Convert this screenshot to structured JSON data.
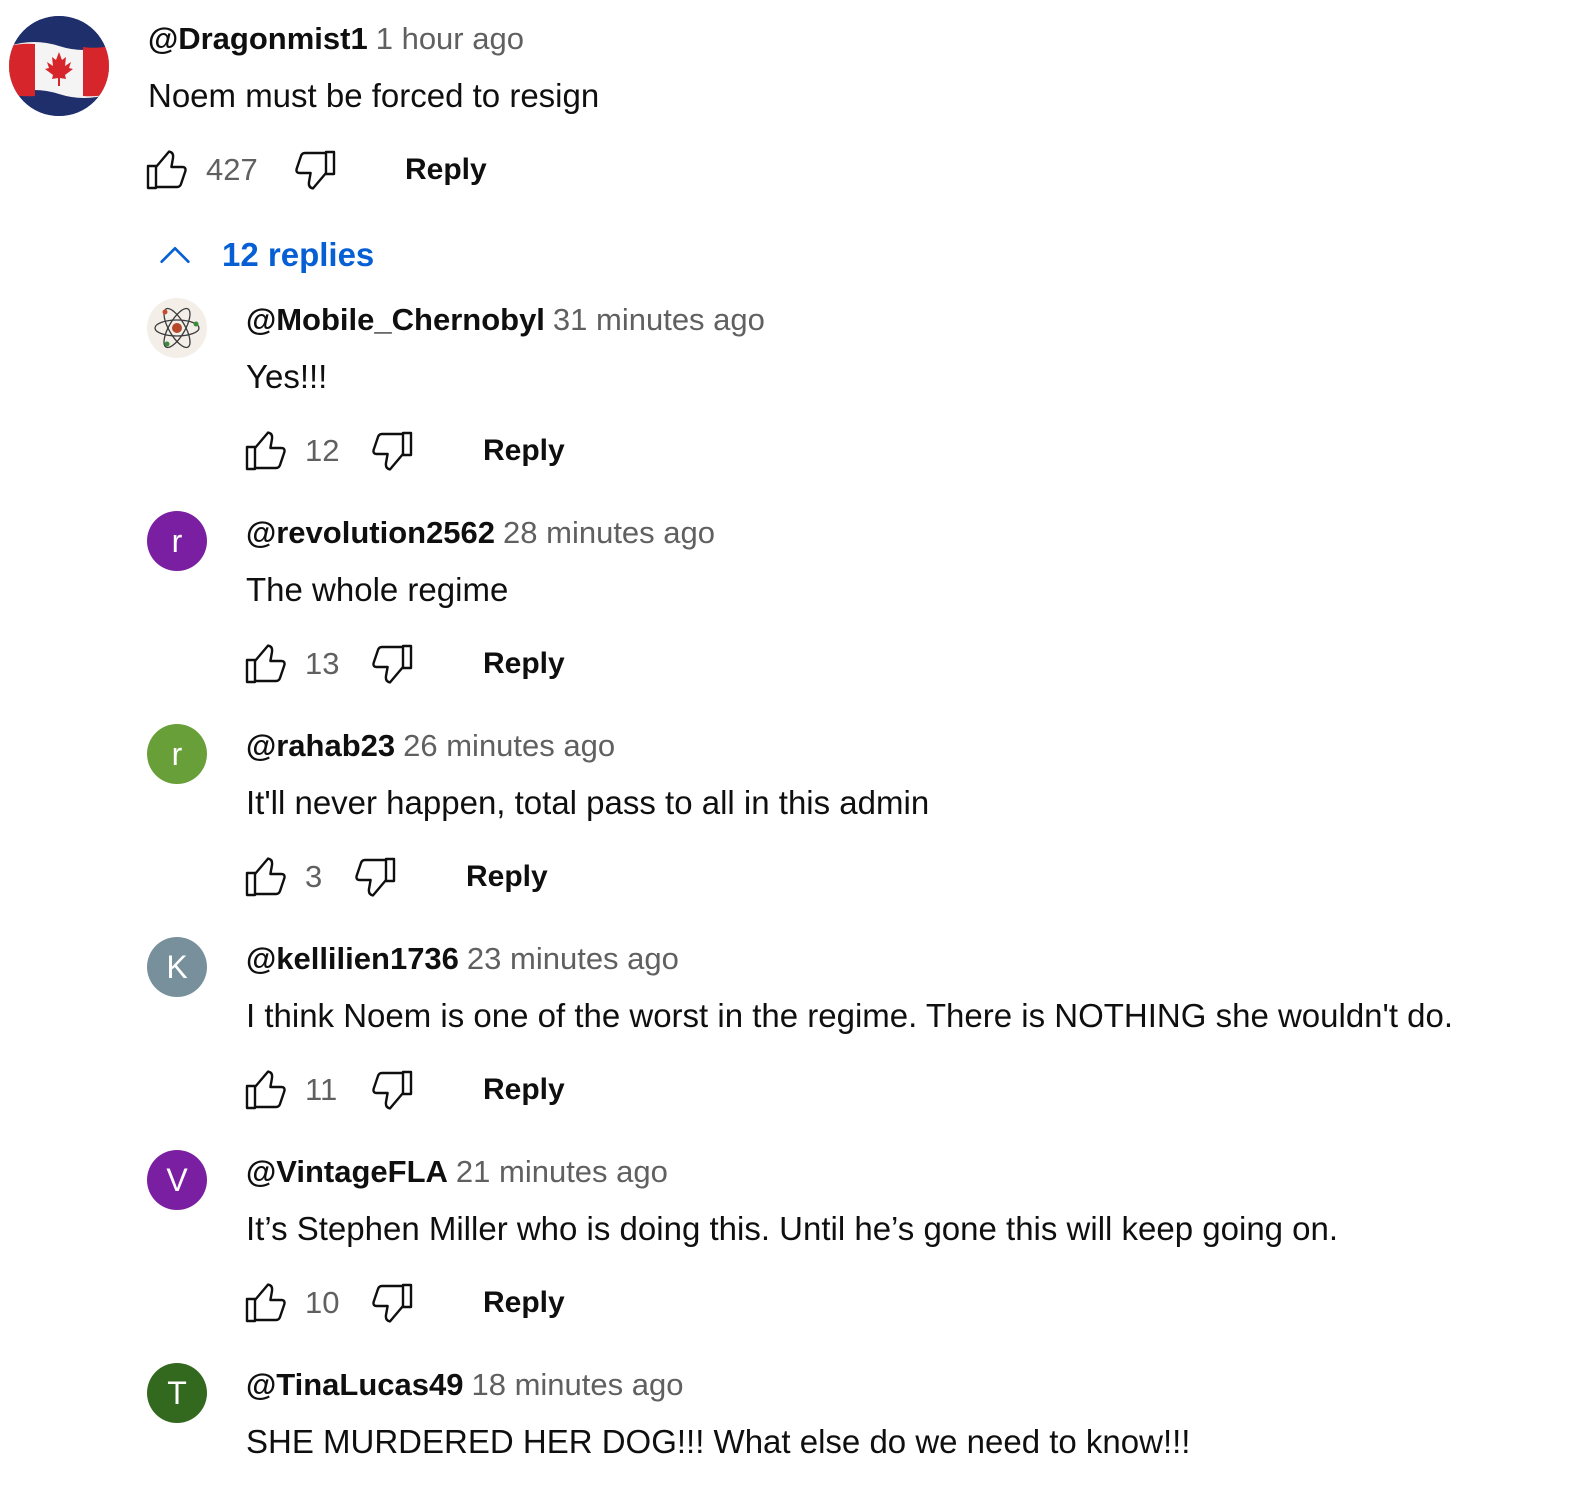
{
  "top_comment": {
    "author": "@Dragonmist1",
    "time": "1 hour ago",
    "text": "Noem must be forced to resign",
    "likes": "427",
    "reply_label": "Reply",
    "avatar": "canada-flag-icon"
  },
  "replies_toggle": {
    "label": "12 replies",
    "icon": "chevron-up-icon"
  },
  "replies": [
    {
      "author": "@Mobile_Chernobyl",
      "time": "31 minutes ago",
      "text": "Yes!!!",
      "likes": "12",
      "reply_label": "Reply",
      "avatar": "atom-icon"
    },
    {
      "author": "@revolution2562",
      "time": "28 minutes ago",
      "text": "The whole regime",
      "likes": "13",
      "reply_label": "Reply",
      "avatar_letter": "r",
      "avatar_color": "#7b1fa2"
    },
    {
      "author": "@rahab23",
      "time": "26 minutes ago",
      "text": "It'll never happen, total pass to all in this admin",
      "likes": "3",
      "reply_label": "Reply",
      "avatar_letter": "r",
      "avatar_color": "#689f38"
    },
    {
      "author": "@kellilien1736",
      "time": "23 minutes ago",
      "text": "I think Noem is one of the worst in the regime.  There is NOTHING she wouldn't do.",
      "likes": "11",
      "reply_label": "Reply",
      "avatar_letter": "K",
      "avatar_color": "#78909c"
    },
    {
      "author": "@VintageFLA",
      "time": "21 minutes ago",
      "text": "It’s Stephen Miller who is doing this. Until he’s gone this will keep going on.",
      "likes": "10",
      "reply_label": "Reply",
      "avatar_letter": "V",
      "avatar_color": "#7b1fa2"
    },
    {
      "author": "@TinaLucas49",
      "time": "18 minutes ago",
      "text": "SHE MURDERED HER DOG!!! What else do we need to know!!!",
      "avatar_letter": "T",
      "avatar_color": "#33691e"
    }
  ],
  "icons": {
    "like": "thumbs-up-icon",
    "dislike": "thumbs-down-icon"
  }
}
